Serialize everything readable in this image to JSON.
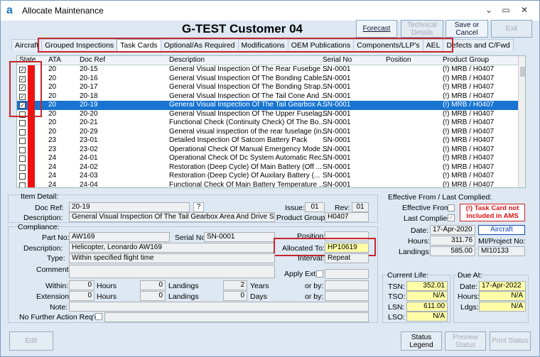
{
  "window": {
    "title": "Allocate Maintenance",
    "logo": "a",
    "controls": [
      "⌄",
      "▭",
      "✕"
    ]
  },
  "header": {
    "title": "G-TEST Customer 04",
    "forecast": "Forecast",
    "technical_details": "Technical Details",
    "save_cancel": "Save or Cancel",
    "exit": "Exit"
  },
  "tabs": [
    "Aircraft",
    "Grouped Inspections",
    "Task Cards",
    "Optional/As Required",
    "Modifications",
    "OEM Publications",
    "Components/LLP's",
    "AEL",
    "Defects and C/Fwd"
  ],
  "grid": {
    "columns": [
      "State",
      "ATA",
      "Doc Ref",
      "Description",
      "Serial No",
      "Position",
      "Product Group"
    ],
    "rows": [
      {
        "checked": true,
        "ata": "20",
        "doc": "20-15",
        "desc": "General Visual Inspection Of The Rear Fusebge ...",
        "serial": "SN-0001",
        "pos": "",
        "pg": "(!) MRB / H0407"
      },
      {
        "checked": true,
        "ata": "20",
        "doc": "20-16",
        "desc": "General Visual Inspection Of The Bonding Cable...",
        "serial": "SN-0001",
        "pos": "",
        "pg": "(!) MRB / H0407"
      },
      {
        "checked": true,
        "ata": "20",
        "doc": "20-17",
        "desc": "General Visual Inspection Of The Bonding Strap...",
        "serial": "SN-0001",
        "pos": "",
        "pg": "(!) MRB / H0407"
      },
      {
        "checked": true,
        "ata": "20",
        "doc": "20-18",
        "desc": "General Visual Inspection Of The Tail Cone And ...",
        "serial": "SN-0001",
        "pos": "",
        "pg": "(!) MRB / H0407"
      },
      {
        "checked": true,
        "ata": "20",
        "doc": "20-19",
        "desc": "General Visual Inspection Of The Tail Gearbox A...",
        "serial": "SN-0001",
        "pos": "",
        "pg": "(!) MRB / H0407",
        "selected": true
      },
      {
        "checked": false,
        "ata": "20",
        "doc": "20-20",
        "desc": "General Visual Inspection Of The Upper Fuselag...",
        "serial": "SN-0001",
        "pos": "",
        "pg": "(!) MRB / H0407"
      },
      {
        "checked": false,
        "ata": "20",
        "doc": "20-21",
        "desc": "Functional Check (Continuity Check)  Of The Bo...",
        "serial": "SN-0001",
        "pos": "",
        "pg": "(!) MRB / H0407"
      },
      {
        "checked": false,
        "ata": "20",
        "doc": "20-29",
        "desc": "General visual inspection of the rear fuselage (in...",
        "serial": "SN-0001",
        "pos": "",
        "pg": "(!) MRB / H0407"
      },
      {
        "checked": false,
        "ata": "23",
        "doc": "23-01",
        "desc": "Detailed Inspection Of Satcom Battery Pack",
        "serial": "SN-0001",
        "pos": "",
        "pg": "(!) MRB / H0407"
      },
      {
        "checked": false,
        "ata": "23",
        "doc": "23-02",
        "desc": "Operational Check Of Manual Emergency Mode ...",
        "serial": "SN-0001",
        "pos": "",
        "pg": "(!) MRB / H0407"
      },
      {
        "checked": false,
        "ata": "24",
        "doc": "24-01",
        "desc": "Operational Check Of Dc System Automatic Rec...",
        "serial": "SN-0001",
        "pos": "",
        "pg": "(!) MRB / H0407"
      },
      {
        "checked": false,
        "ata": "24",
        "doc": "24-02",
        "desc": "Restoration (Deep Cycle) Of Main Battery  (Off ...",
        "serial": "SN-0001",
        "pos": "",
        "pg": "(!) MRB / H0407"
      },
      {
        "checked": false,
        "ata": "24",
        "doc": "24-03",
        "desc": "Restoration (Deep Cycle) Of Auxilary Battery  (...",
        "serial": "SN-0001",
        "pos": "",
        "pg": "(!) MRB / H0407"
      },
      {
        "checked": false,
        "ata": "24",
        "doc": "24-04",
        "desc": "Functional Check Of Main Battery Temperature ...",
        "serial": "SN-0001",
        "pos": "",
        "pg": "(!) MRB / H0407"
      }
    ]
  },
  "item_detail": {
    "group": "Item Detail:",
    "doc_ref_label": "Doc Ref:",
    "doc_ref": "20-19",
    "help": "?",
    "issue_label": "Issue:",
    "issue": "01",
    "rev_label": "Rev:",
    "rev": "01",
    "description_label": "Description:",
    "description": "General Visual Inspection Of The Tail Gearbox Area And Drive Shaft Co",
    "product_group_label": "Product Group:",
    "product_group": "H0407"
  },
  "compliance": {
    "group": "Compliance:",
    "part_no_label": "Part No:",
    "part_no": "AW169",
    "serial_no_label": "Serial No:",
    "serial_no": "SN-0001",
    "position_label": "Position:",
    "description_label": "Description:",
    "description": "Helicopter, Leonardo AW169",
    "allocated_to_label": "Allocated To:",
    "allocated_to": "HP10619",
    "type_label": "Type:",
    "type": "Within specified flight time",
    "interval_label": "Interval:",
    "interval": "Repeat",
    "comment_label": "Comment:",
    "apply_ext_label": "Apply Ext:",
    "within_label": "Within:",
    "within_hours": "0",
    "hours_label": "Hours",
    "within_landings": "0",
    "landings_label": "Landings",
    "within_years": "2",
    "years_label": "Years",
    "or_by_label": "or by:",
    "extension_label": "Extension:",
    "ext_hours": "0",
    "ext_landings": "0",
    "ext_days": "0",
    "days_label": "Days",
    "note_label": "Note:",
    "nfar_label": "No Further Action Req'd:"
  },
  "effective": {
    "group": "Effective From / Last Complied:",
    "effective_from_label": "Effective From:",
    "last_complied_label": "Last Complied:",
    "warning": "(!) Task Card not included in AMS",
    "date_label": "Date:",
    "date": "17-Apr-2020",
    "aircraft": "Aircraft",
    "hours_label": "Hours:",
    "hours": "311.76",
    "mi_project_label": "MI/Project No:",
    "landings_label": "Landings:",
    "landings": "585.00",
    "mi": "MI10133"
  },
  "current_life": {
    "group": "Current Life:",
    "tsn_label": "TSN:",
    "tsn": "352.01",
    "tso_label": "TSO:",
    "tso": "N/A",
    "lsn_label": "LSN:",
    "lsn": "611.00",
    "lso_label": "LSO:",
    "lso": "N/A"
  },
  "due_at": {
    "group": "Due At:",
    "date_label": "Date:",
    "date": "17-Apr-2022",
    "hours_label": "Hours:",
    "hours": "N/A",
    "ldgs_label": "Ldgs:",
    "ldgs": "N/A"
  },
  "footer": {
    "edit": "Edit",
    "status_legend": "Status Legend",
    "preview_status": "Preview Status",
    "print_status": "Print Status"
  },
  "colors": {
    "selection": "#1874d0",
    "state_red": "#ee1111",
    "highlight_box": "#c8262a",
    "yellow_field": "#ffffa8"
  }
}
